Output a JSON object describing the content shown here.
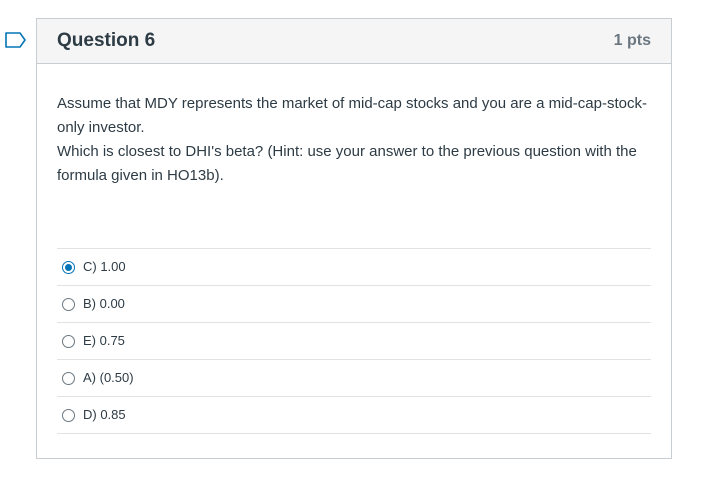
{
  "question": {
    "title": "Question 6",
    "points": "1 pts",
    "paragraphs": [
      "Assume that MDY represents the market of mid-cap stocks and you are a mid-cap-stock-only investor.",
      "Which is closest to DHI's beta? (Hint: use your answer to the previous question with the formula given in HO13b)."
    ],
    "answers": [
      {
        "label": "C) 1.00",
        "selected": true
      },
      {
        "label": "B) 0.00",
        "selected": false
      },
      {
        "label": "E) 0.75",
        "selected": false
      },
      {
        "label": "A) (0.50)",
        "selected": false
      },
      {
        "label": "D) 0.85",
        "selected": false
      }
    ]
  },
  "colors": {
    "accent": "#0374b5",
    "header_bg": "#f5f5f5",
    "border": "#c7cdd1",
    "text": "#2d3b45"
  },
  "icons": {
    "flag": "bookmark-flag-icon"
  }
}
